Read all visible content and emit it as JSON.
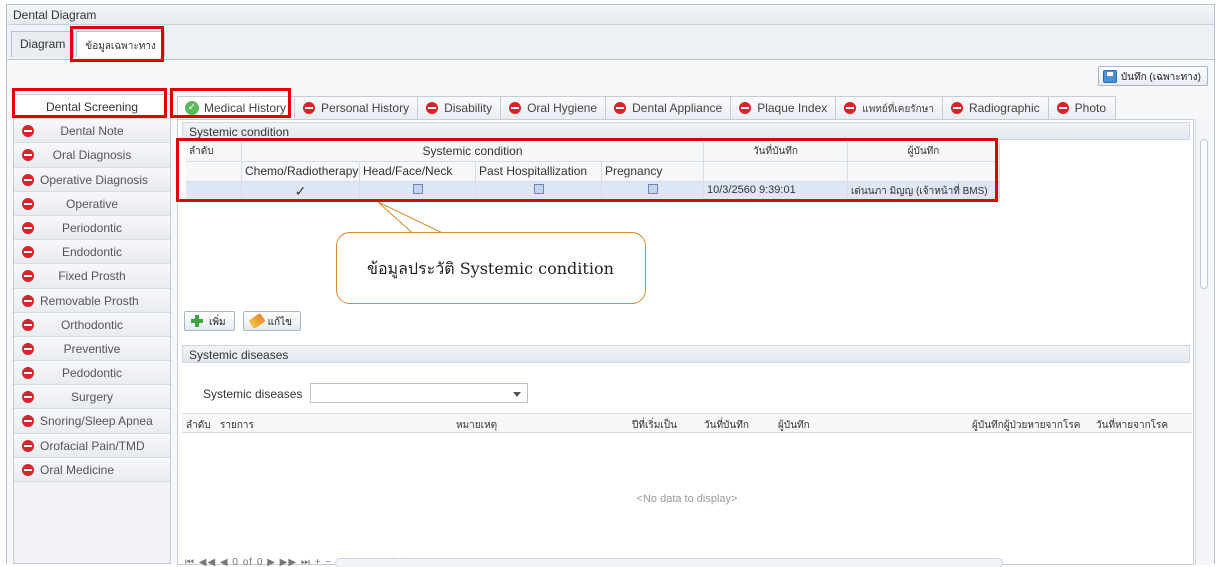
{
  "window": {
    "title": "Dental Diagram"
  },
  "top_tabs": [
    {
      "label": "Diagram"
    },
    {
      "label": "ข้อมูลเฉพาะทาง"
    }
  ],
  "toolbar": {
    "save_label": "บันทึก (เฉพาะทาง)"
  },
  "sidebar": {
    "items": [
      {
        "label": "Dental Screening"
      },
      {
        "label": "Dental Note"
      },
      {
        "label": "Oral Diagnosis"
      },
      {
        "label": "Operative Diagnosis"
      },
      {
        "label": "Operative"
      },
      {
        "label": "Periodontic"
      },
      {
        "label": "Endodontic"
      },
      {
        "label": "Fixed Prosth"
      },
      {
        "label": "Removable Prosth"
      },
      {
        "label": "Orthodontic"
      },
      {
        "label": "Preventive"
      },
      {
        "label": "Pedodontic"
      },
      {
        "label": "Surgery"
      },
      {
        "label": "Snoring/Sleep Apnea"
      },
      {
        "label": "Orofacial Pain/TMD"
      },
      {
        "label": "Oral Medicine"
      }
    ]
  },
  "sub_tabs": [
    {
      "label": "Medical History"
    },
    {
      "label": "Personal History"
    },
    {
      "label": "Disability"
    },
    {
      "label": "Oral Hygiene"
    },
    {
      "label": "Dental Appliance"
    },
    {
      "label": "Plaque Index"
    },
    {
      "label": "แพทย์ที่เคยรักษา"
    },
    {
      "label": "Radiographic"
    },
    {
      "label": "Photo"
    }
  ],
  "systemic_condition": {
    "section_title": "Systemic condition",
    "headers": {
      "order": "ลำดับ",
      "group": "Systemic condition",
      "date": "วันที่บันทึก",
      "recorder": "ผู้บันทึก"
    },
    "sub_headers": [
      "Chemo/Radiotherapy",
      "Head/Face/Neck",
      "Past Hospitallization",
      "Pregnancy"
    ],
    "rows": [
      {
        "checkmark": "✓",
        "date": "10/3/2560 9:39:01",
        "recorder": "เด่นนภา มิญญ (เจ้าหน้าที่ BMS)"
      }
    ],
    "callout": "ข้อมูลประวัติ Systemic condition",
    "add_label": "เพิ่ม",
    "edit_label": "แก้ไข"
  },
  "systemic_diseases": {
    "section_title": "Systemic diseases",
    "filter_label": "Systemic diseases",
    "columns": [
      "ลำดับ",
      "รายการ",
      "หมายเหตุ",
      "ปีที่เริ่มเป็น",
      "วันที่บันทึก",
      "ผู้บันทึก",
      "ผู้บันทึกผู้ป่วยหายจากโรค",
      "วันที่หายจากโรค"
    ],
    "empty_text": "<No data to display>"
  },
  "pager": {
    "text": "⏮ ◀◀ ◀  0 of 0  ▶ ▶▶ ⏭ + − ▲ ✓ ✕ ↻ ✱ ✳ ▼"
  }
}
